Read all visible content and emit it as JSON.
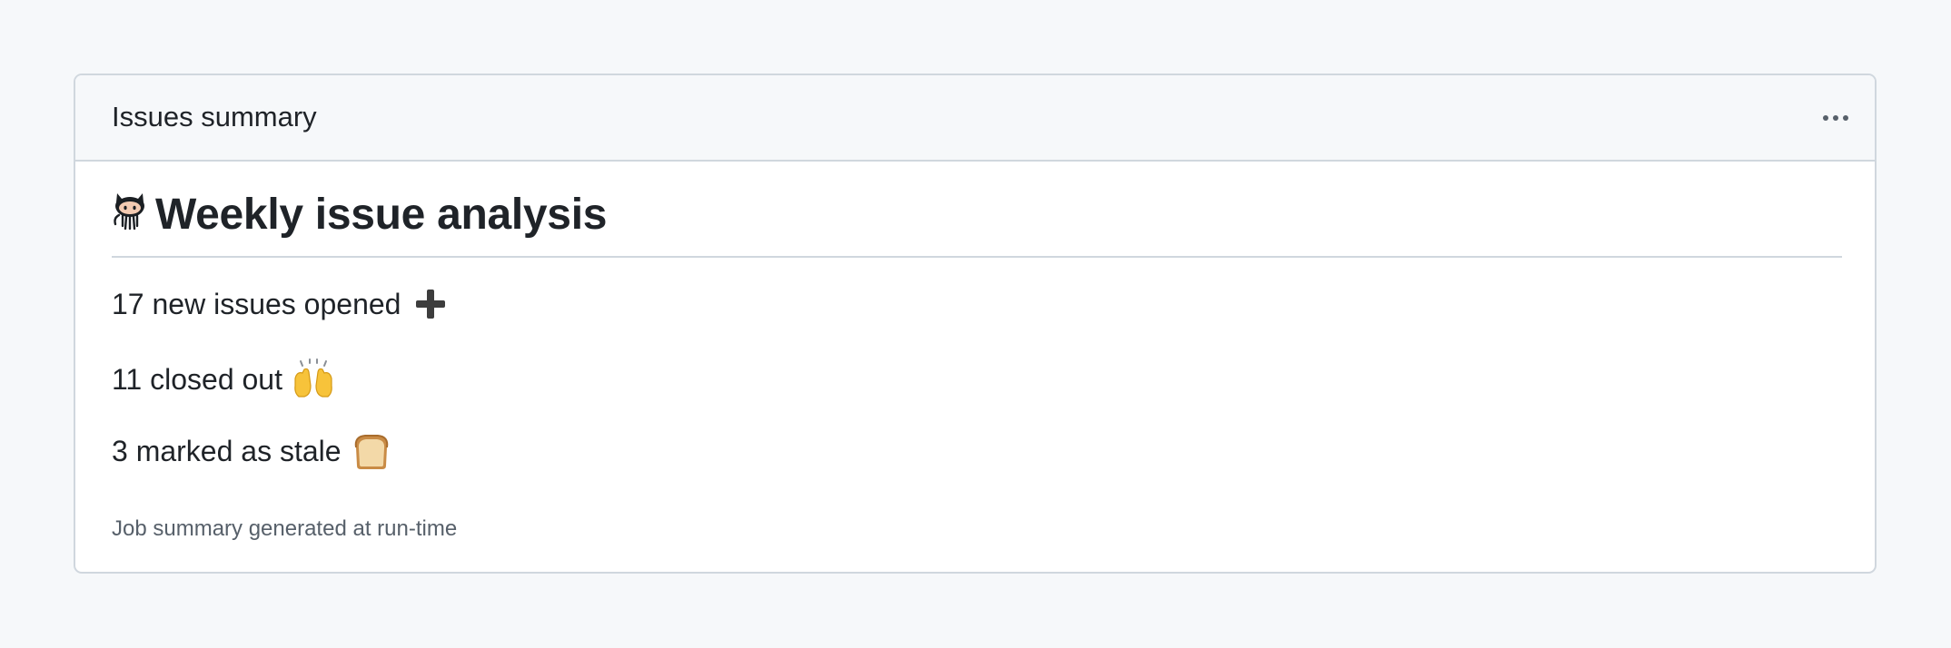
{
  "card": {
    "title": "Issues summary",
    "menu_icon": "kebab-horizontal-icon"
  },
  "report": {
    "heading_icon": "octocat-icon",
    "heading": "Weekly issue analysis",
    "stats": [
      {
        "text": "17 new issues opened",
        "icon": "heavy-plus-icon"
      },
      {
        "text": "11 closed out",
        "icon": "raising-hands-icon"
      },
      {
        "text": "3 marked as stale",
        "icon": "bread-icon"
      }
    ],
    "footnote": "Job summary generated at run-time"
  },
  "colors": {
    "page_bg": "#f6f8fa",
    "border": "#d0d7de",
    "text": "#1f2328",
    "muted": "#57606a"
  }
}
